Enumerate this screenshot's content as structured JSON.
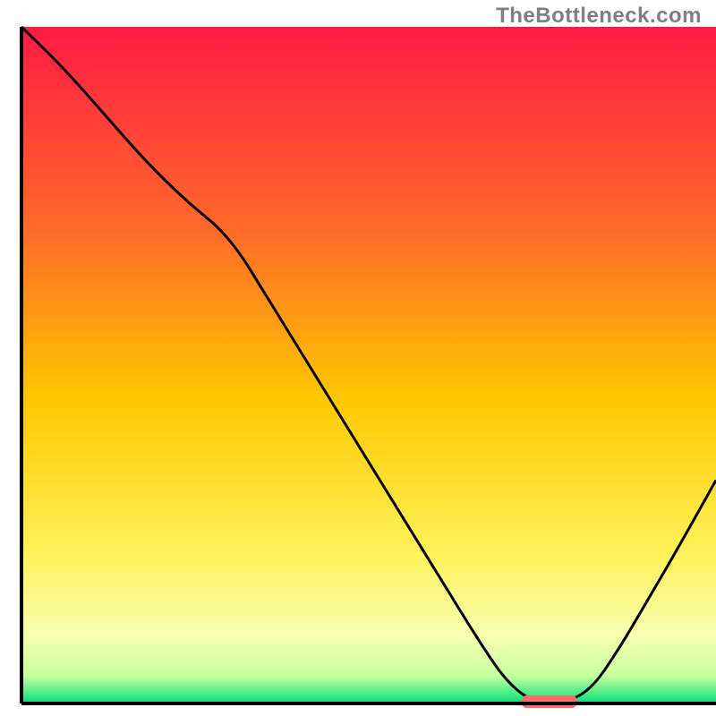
{
  "watermark": "TheBottleneck.com",
  "chart_data": {
    "type": "line",
    "title": "",
    "xlabel": "",
    "ylabel": "",
    "xlim": [
      0,
      100
    ],
    "ylim": [
      0,
      100
    ],
    "grid": false,
    "legend": false,
    "background_gradient_stops": [
      {
        "offset": 0.0,
        "color": "#ff1a44"
      },
      {
        "offset": 0.3,
        "color": "#ff6a2a"
      },
      {
        "offset": 0.55,
        "color": "#ffc800"
      },
      {
        "offset": 0.78,
        "color": "#fff25a"
      },
      {
        "offset": 0.9,
        "color": "#f8ffb0"
      },
      {
        "offset": 0.96,
        "color": "#c5ff9e"
      },
      {
        "offset": 1.0,
        "color": "#00e07a"
      }
    ],
    "series": [
      {
        "name": "bottleneck-curve",
        "color": "#000000",
        "x": [
          0,
          6,
          12,
          18,
          24,
          30,
          36,
          42,
          48,
          54,
          60,
          66,
          70,
          74,
          78,
          82,
          86,
          90,
          94,
          100
        ],
        "y": [
          100,
          94,
          87,
          80,
          74,
          69,
          59,
          49,
          39,
          29,
          19,
          9,
          3,
          0,
          0,
          2,
          8,
          15,
          22,
          33
        ]
      }
    ],
    "marker": {
      "name": "optimal-marker",
      "color": "#ff6a6a",
      "x_center": 76,
      "y_center": 0,
      "width": 8,
      "height": 2
    }
  }
}
